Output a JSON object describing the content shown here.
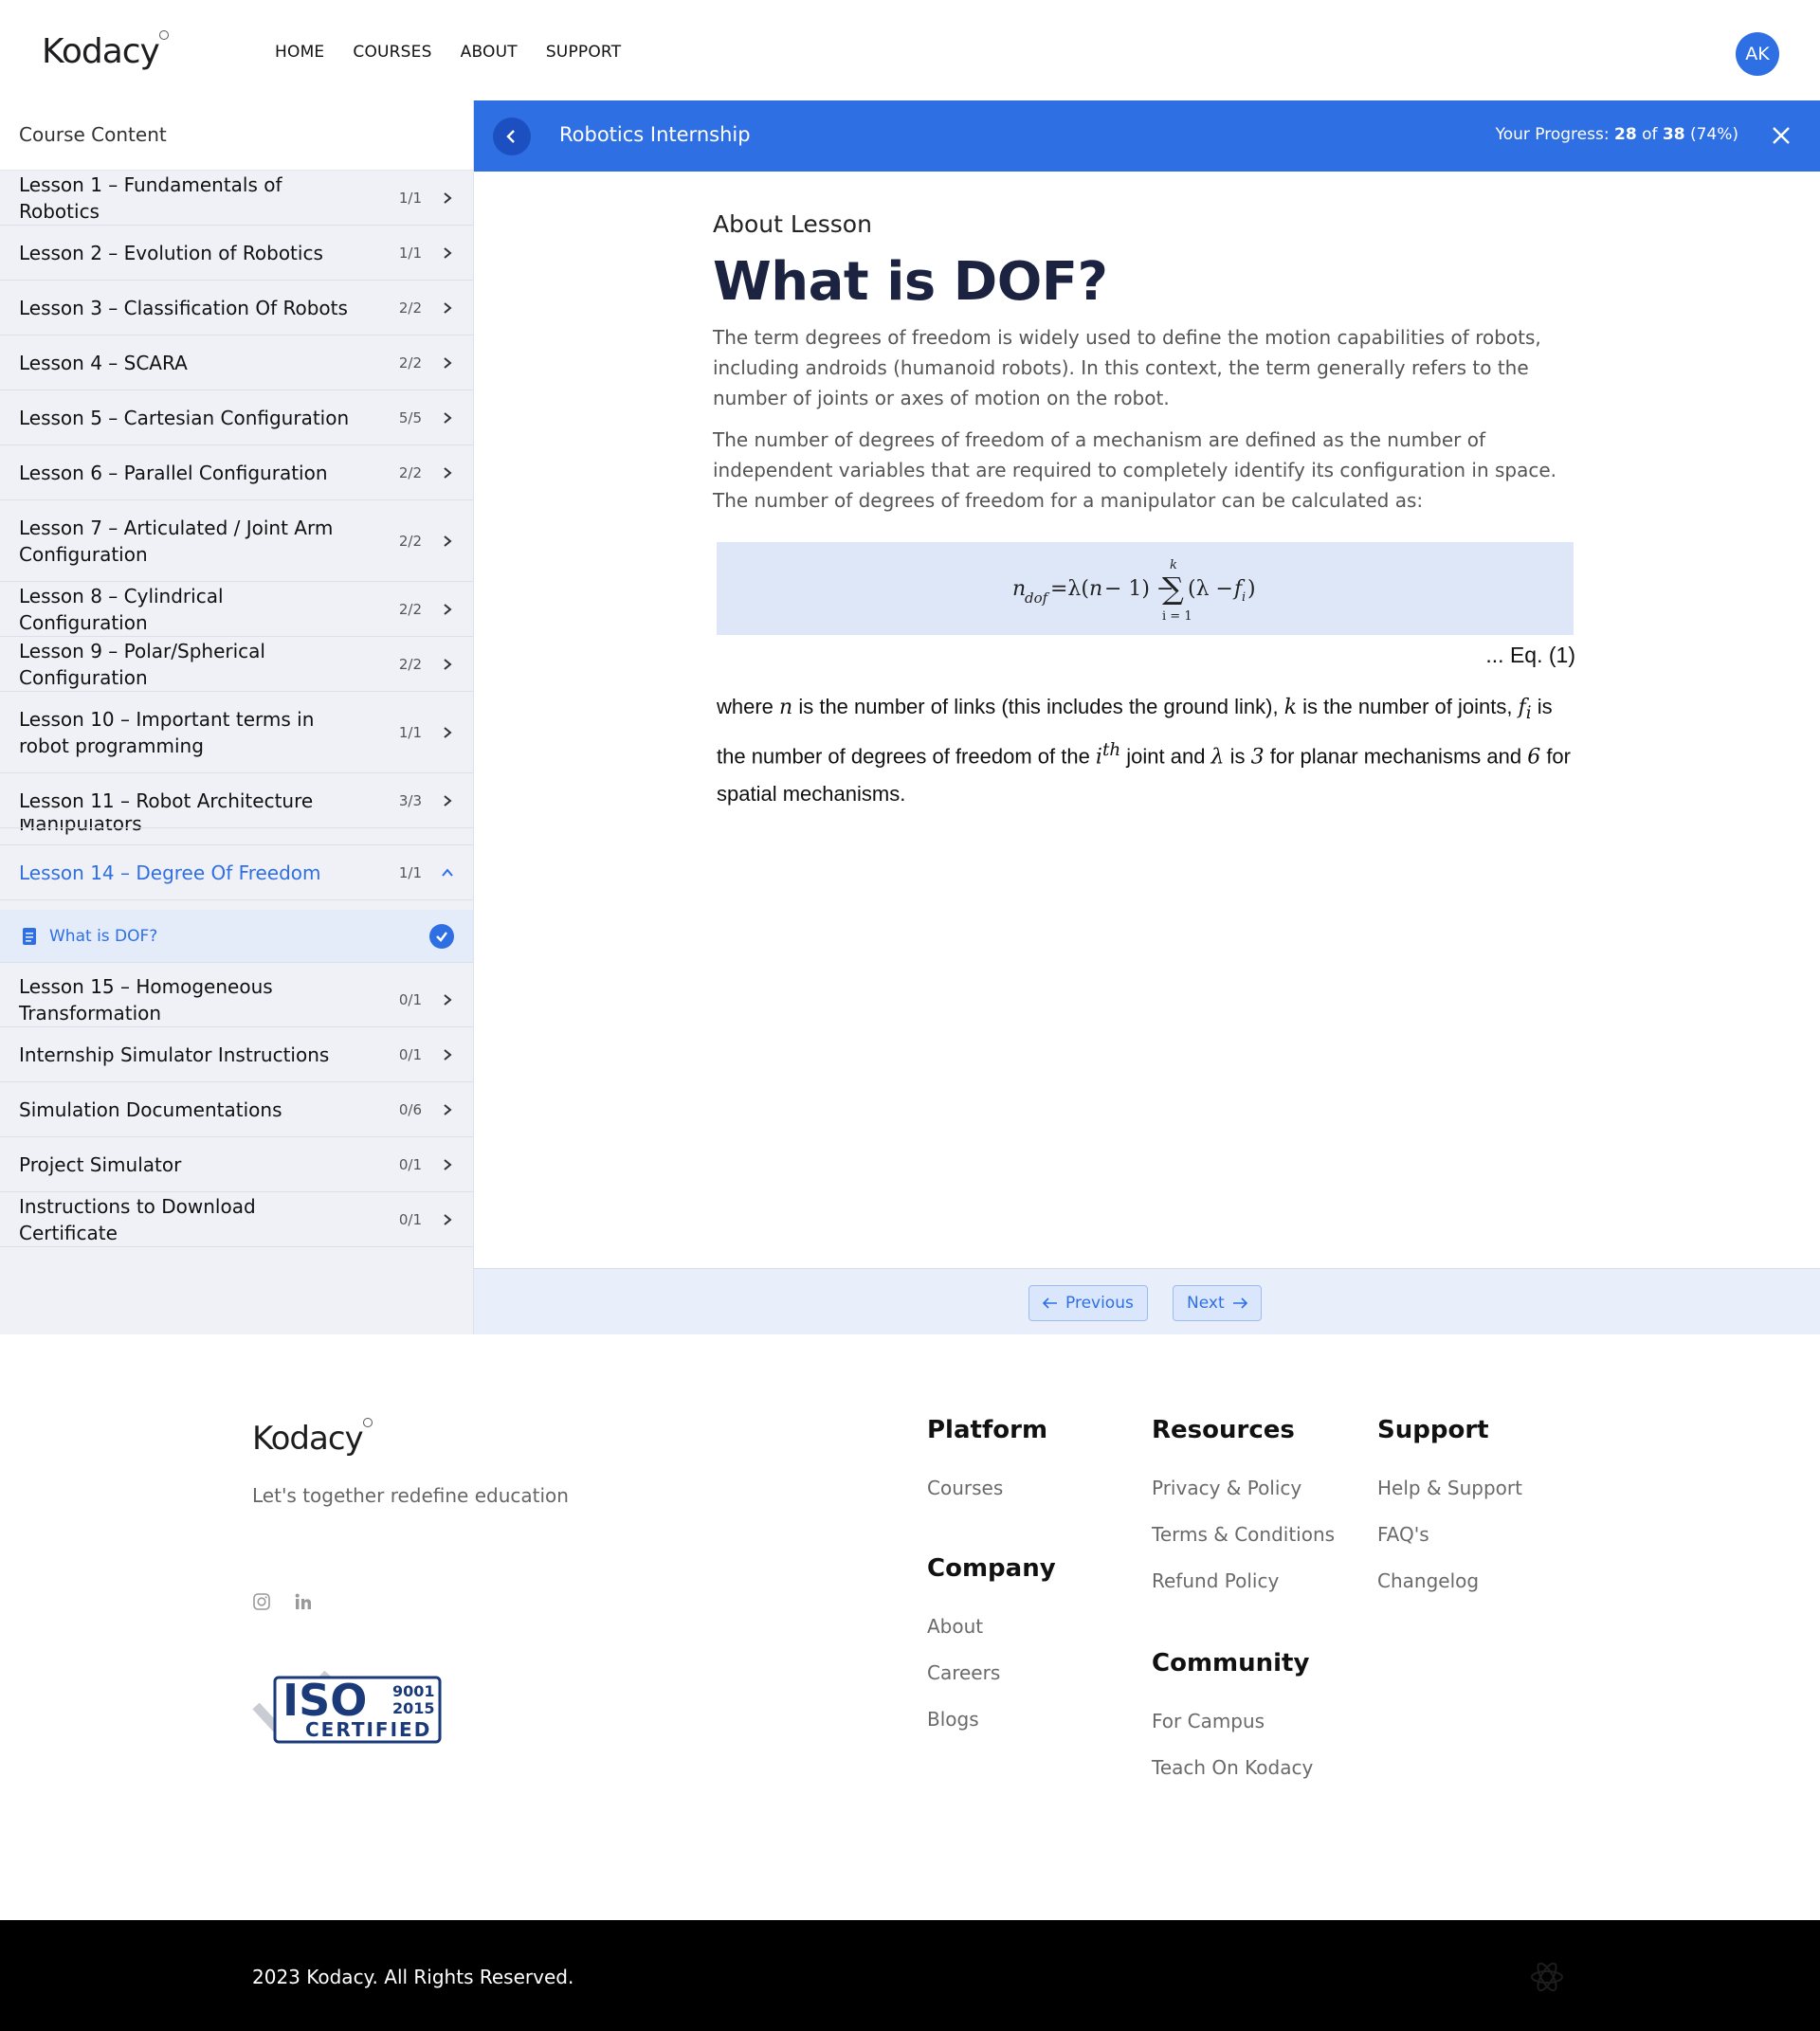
{
  "header": {
    "logo": "Kodacy",
    "nav": [
      "HOME",
      "COURSES",
      "ABOUT",
      "SUPPORT"
    ],
    "avatar": "AK"
  },
  "sidebar": {
    "title": "Course Content",
    "lessons_top": [
      {
        "title": "Lesson 1 – Fundamentals of Robotics",
        "count": "1/1"
      },
      {
        "title": "Lesson 2 – Evolution of Robotics",
        "count": "1/1"
      },
      {
        "title": "Lesson 3 – Classification Of Robots",
        "count": "2/2"
      },
      {
        "title": "Lesson 4 – SCARA",
        "count": "2/2"
      },
      {
        "title": "Lesson 5 – Cartesian Configuration",
        "count": "5/5"
      },
      {
        "title": "Lesson 6 – Parallel Configuration",
        "count": "2/2"
      },
      {
        "title": "Lesson 7 – Articulated / Joint Arm Configuration",
        "count": "2/2"
      },
      {
        "title": "Lesson 8 – Cylindrical Configuration",
        "count": "2/2"
      },
      {
        "title": "Lesson 9 – Polar/Spherical Configuration",
        "count": "2/2"
      },
      {
        "title": "Lesson 10 – Important terms in robot programming",
        "count": "1/1"
      },
      {
        "title": "Lesson 11 – Robot Architecture",
        "count": "3/3"
      }
    ],
    "partial_text": "Manipulators",
    "active_lesson": {
      "title": "Lesson 14 – Degree Of Freedom",
      "count": "1/1"
    },
    "active_topic": "What is DOF?",
    "lessons_bottom": [
      {
        "title": "Lesson 15 – Homogeneous Transformation",
        "count": "0/1"
      },
      {
        "title": "Internship Simulator Instructions",
        "count": "0/1"
      },
      {
        "title": "Simulation Documentations",
        "count": "0/6"
      },
      {
        "title": "Project Simulator",
        "count": "0/1"
      },
      {
        "title": "Instructions to Download Certificate",
        "count": "0/1"
      }
    ]
  },
  "coursebar": {
    "title": "Robotics Internship",
    "progress_label": "Your Progress:",
    "progress_done": "28",
    "progress_of": "of",
    "progress_total": "38",
    "progress_pct": "(74%)"
  },
  "content": {
    "about_label": "About Lesson",
    "title": "What is DOF?",
    "para1": "The term degrees of freedom is widely used to define the motion capabilities of robots, including androids (humanoid robots). In this context, the term generally refers to the number of joints or axes of motion on the robot.",
    "para2": "The number of degrees of freedom of a mechanism are defined as the number of independent variables that are required to completely identify its configuration in space. The number of degrees of freedom for a manipulator can be calculated as:",
    "eq_ref": "... Eq. (1)",
    "where_1": "where ",
    "where_n": "n",
    "where_2": " is the number of links (this includes the ground link), ",
    "where_k": "k",
    "where_3": " is the number of joints, ",
    "where_f": "f",
    "where_fi": "i",
    "where_4": " is the number of degrees of freedom of the ",
    "where_i": "i",
    "where_th": "th",
    "where_5": " joint and ",
    "where_lambda": "λ",
    "where_6": " is ",
    "where_3n": "3",
    "where_7": " for planar mechanisms and ",
    "where_6n": "6",
    "where_8": " for spatial mechanisms."
  },
  "pager": {
    "previous": "Previous",
    "next": "Next"
  },
  "footer": {
    "logo": "Kodacy",
    "tagline": "Let's together redefine education",
    "iso_top": "ISO",
    "iso_num1": "9001",
    "iso_num2": "2015",
    "iso_certified": "CERTIFIED",
    "platform": {
      "heading": "Platform",
      "links": [
        "Courses"
      ]
    },
    "company": {
      "heading": "Company",
      "links": [
        "About",
        "Careers",
        "Blogs"
      ]
    },
    "resources": {
      "heading": "Resources",
      "links": [
        "Privacy & Policy",
        "Terms & Conditions",
        "Refund Policy"
      ]
    },
    "community": {
      "heading": "Community",
      "links": [
        "For Campus",
        "Teach On Kodacy"
      ]
    },
    "support": {
      "heading": "Support",
      "links": [
        "Help & Support",
        "FAQ's",
        "Changelog"
      ]
    },
    "copyright": "2023 Kodacy. All Rights Reserved."
  },
  "colors": {
    "accent": "#2f6fe4",
    "sidebar_bg": "#eff1f6",
    "footer_bar": "#000000"
  }
}
